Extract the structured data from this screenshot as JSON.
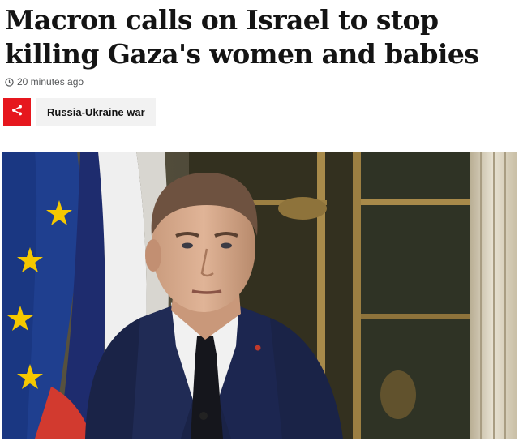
{
  "article": {
    "headline": "Macron calls on Israel to stop killing Gaza's women and babies",
    "timestamp": "20 minutes ago",
    "topic_label": "Russia-Ukraine war"
  },
  "icons": {
    "timestamp": "clock-icon",
    "share": "share-icon"
  },
  "colors": {
    "share_button": "#e6171e",
    "topic_background": "#f2f2f2",
    "headline_text": "#141414",
    "meta_text": "#545658"
  },
  "photo": {
    "subject": "Emmanuel Macron in navy suit during TV interview, EU and French flags behind"
  }
}
